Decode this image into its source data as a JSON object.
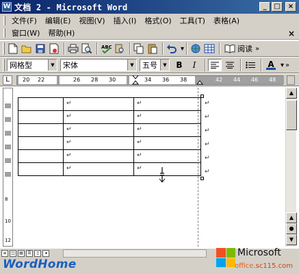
{
  "window": {
    "title": "文档 2 - Microsoft Word",
    "icon_letter": "W",
    "minimize": "_",
    "maximize": "□",
    "close": "×"
  },
  "menu": {
    "row1": [
      "文件(F)",
      "编辑(E)",
      "视图(V)",
      "插入(I)",
      "格式(O)",
      "工具(T)",
      "表格(A)"
    ],
    "row2": [
      "窗口(W)",
      "帮助(H)"
    ],
    "close_x": "×"
  },
  "toolbar_standard": {
    "read_label": "阅读",
    "icons": [
      "new-icon",
      "open-icon",
      "save-icon",
      "permission-icon",
      "print-icon",
      "print-preview-icon",
      "spelling-icon",
      "research-icon",
      "copy-icon",
      "paste-icon",
      "undo-icon",
      "hyperlink-icon",
      "table-icon",
      "read-icon"
    ]
  },
  "toolbar_format": {
    "style": "网格型",
    "font": "宋体",
    "size": "五号",
    "bold": "B",
    "italic": "I",
    "font_color_label": "A"
  },
  "ruler": {
    "numbers": [
      "20",
      "22",
      "26",
      "28",
      "30",
      "34",
      "36",
      "38",
      "42",
      "44",
      "46",
      "48"
    ]
  },
  "vruler": {
    "numbers": [
      "8",
      "10",
      "12"
    ]
  },
  "document": {
    "cell_mark": "↵",
    "rows": 6
  },
  "footer": {
    "brand": "WordHome",
    "ms_name": "Microsoft",
    "ms_url_prefix": "office",
    "ms_url_suffix": ".sc115.com"
  },
  "colors": {
    "titlebar_start": "#0a246a",
    "titlebar_end": "#3a6ea5",
    "chrome": "#d4d0c8",
    "brand_blue": "#1a5fbf",
    "ms_red": "#f25022",
    "ms_green": "#7fba00",
    "ms_blue": "#00a4ef",
    "ms_yellow": "#ffb900"
  }
}
